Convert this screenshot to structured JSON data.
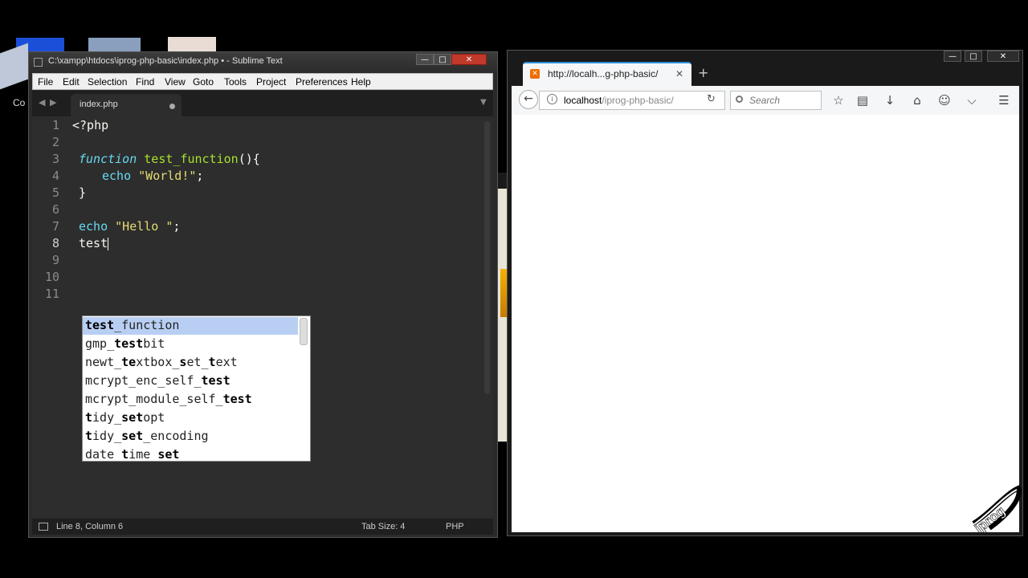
{
  "desktop": {
    "label": "Co"
  },
  "sublime": {
    "title": "C:\\xampp\\htdocs\\iprog-php-basic\\index.php • - Sublime Text",
    "menu": [
      "File",
      "Edit",
      "Selection",
      "Find",
      "View",
      "Goto",
      "Tools",
      "Project",
      "Preferences",
      "Help"
    ],
    "tab": {
      "label": "index.php"
    },
    "line_numbers": [
      "1",
      "2",
      "3",
      "4",
      "5",
      "6",
      "7",
      "8",
      "9",
      "10",
      "11"
    ],
    "active_line": "8",
    "code": {
      "l1": "<?php",
      "l3_kw": "function",
      "l3_name": "test_function",
      "l3_rest": "(){",
      "l4_kw": "echo",
      "l4_str": "\"World!\"",
      "l4_end": ";",
      "l5": "}",
      "l7_kw": "echo",
      "l7_str": "\"Hello \"",
      "l7_end": ";",
      "l8": "test"
    },
    "autocomplete": [
      {
        "text": "test_function"
      },
      {
        "text": "gmp_testbit"
      },
      {
        "text": "newt_textbox_set_text"
      },
      {
        "text": "mcrypt_enc_self_test"
      },
      {
        "text": "mcrypt_module_self_test"
      },
      {
        "text": "tidy_setopt"
      },
      {
        "text": "tidy_set_encoding"
      },
      {
        "text": "date_time_set"
      }
    ],
    "status": {
      "position": "Line 8, Column 6",
      "tab_size": "Tab Size: 4",
      "syntax": "PHP"
    }
  },
  "firefox": {
    "tab": {
      "label": "http://localh...g-php-basic/"
    },
    "url_host": "localhost",
    "url_path": "/iprog-php-basic/",
    "search_placeholder": "Search"
  },
  "logo": {
    "text": "iprog"
  },
  "colors": {
    "keyword": "#66d9ef",
    "function_name": "#a6e22e",
    "string": "#e6db74",
    "selection": "#b8cff3",
    "close_button": "#c0392b",
    "firefox_accent": "#2a90d9"
  },
  "icons": [
    "back-arrow-icon",
    "info-icon",
    "reload-icon",
    "search-icon",
    "bookmark-star-icon",
    "reading-list-icon",
    "download-icon",
    "home-icon",
    "sync-icon",
    "pocket-icon",
    "hamburger-menu-icon"
  ]
}
